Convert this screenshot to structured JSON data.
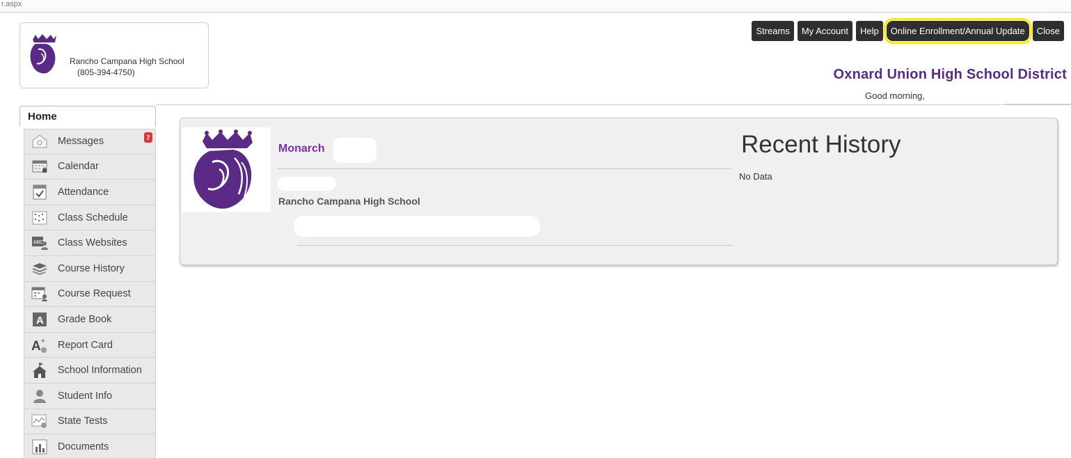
{
  "url_fragment": "r.aspx",
  "school": {
    "name": "Rancho Campana High School",
    "phone": "(805-394-4750)"
  },
  "topnav": [
    {
      "label": "Streams",
      "highlight": false
    },
    {
      "label": "My Account",
      "highlight": false
    },
    {
      "label": "Help",
      "highlight": false
    },
    {
      "label": "Online Enrollment/Annual Update",
      "highlight": true
    },
    {
      "label": "Close",
      "highlight": false
    }
  ],
  "district": "Oxnard Union High School District",
  "greeting": "Good morning,",
  "home_tab": "Home",
  "sidebar": [
    {
      "label": "Messages",
      "icon": "messages-icon",
      "badge": "7"
    },
    {
      "label": "Calendar",
      "icon": "calendar-icon"
    },
    {
      "label": "Attendance",
      "icon": "attendance-icon"
    },
    {
      "label": "Class Schedule",
      "icon": "class-schedule-icon"
    },
    {
      "label": "Class Websites",
      "icon": "class-websites-icon"
    },
    {
      "label": "Course History",
      "icon": "course-history-icon"
    },
    {
      "label": "Course Request",
      "icon": "course-request-icon"
    },
    {
      "label": "Grade Book",
      "icon": "grade-book-icon"
    },
    {
      "label": "Report Card",
      "icon": "report-card-icon"
    },
    {
      "label": "School Information",
      "icon": "school-information-icon"
    },
    {
      "label": "Student Info",
      "icon": "student-info-icon"
    },
    {
      "label": "State Tests",
      "icon": "state-tests-icon"
    },
    {
      "label": "Documents",
      "icon": "documents-icon"
    }
  ],
  "student_card": {
    "name": "Monarch",
    "school": "Rancho Campana High School"
  },
  "recent_history": {
    "title": "Recent History",
    "empty": "No Data"
  },
  "colors": {
    "brand_purple": "#5b2a86",
    "name_purple": "#7b2bb0",
    "highlight": "#ffea00",
    "button_bg": "#2f2f2f"
  }
}
